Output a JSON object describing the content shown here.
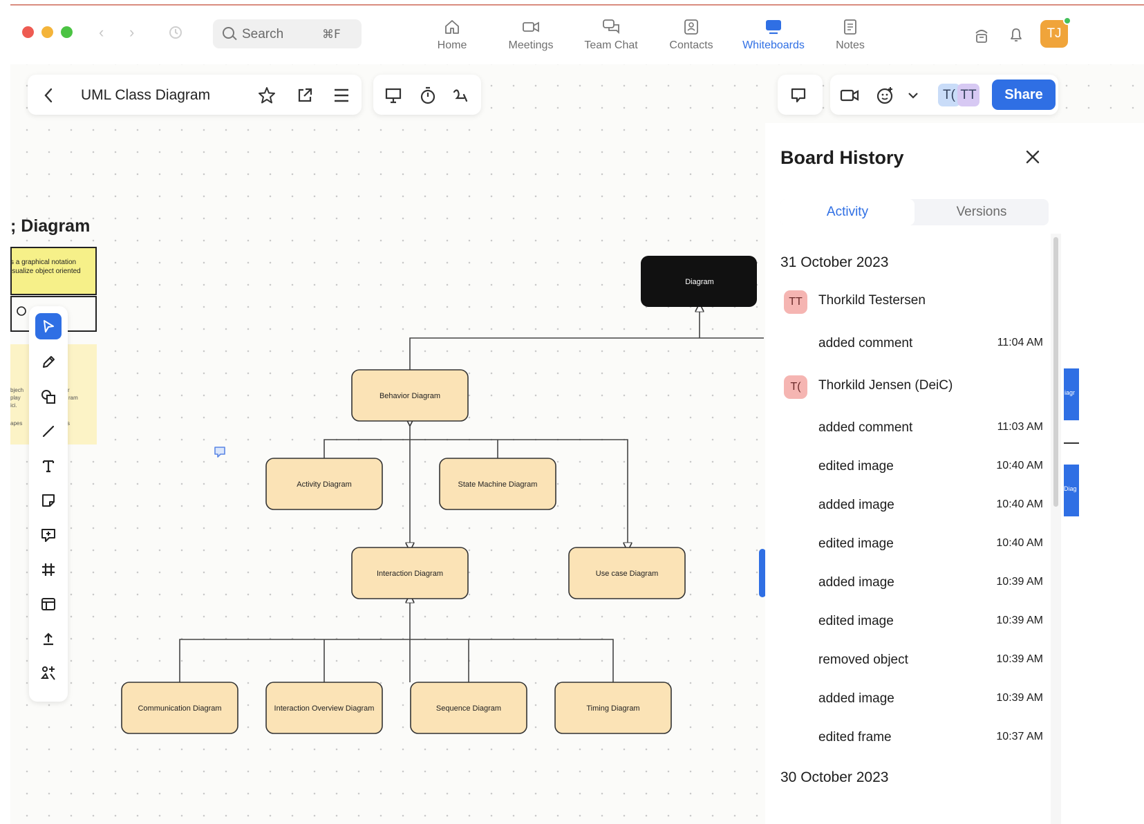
{
  "search": {
    "placeholder": "Search",
    "shortcut": "⌘F"
  },
  "nav_tabs": [
    {
      "label": "Home",
      "icon": "home-icon"
    },
    {
      "label": "Meetings",
      "icon": "video-camera-icon"
    },
    {
      "label": "Team Chat",
      "icon": "chat-bubbles-icon"
    },
    {
      "label": "Contacts",
      "icon": "contact-card-icon"
    },
    {
      "label": "Whiteboards",
      "icon": "whiteboard-icon",
      "active": true
    },
    {
      "label": "Notes",
      "icon": "notes-icon"
    }
  ],
  "user": {
    "initials": "TJ"
  },
  "board": {
    "title": "UML Class Diagram"
  },
  "collaborators": [
    "T(",
    "TT"
  ],
  "share_label": "Share",
  "left_frame": {
    "heading": "; Diagram",
    "sticky_line1": "s a graphical notation",
    "sticky_line2": "isualize object oriented",
    "pale_fragments": [
      "bjech",
      "r",
      "play",
      "ram",
      "ici.",
      "apes",
      "s"
    ]
  },
  "diagram": {
    "nodes": [
      {
        "id": "diagram",
        "label": "Diagram",
        "dark": true
      },
      {
        "id": "behavior",
        "label": "Behavior Diagram"
      },
      {
        "id": "activity",
        "label": "Activity Diagram"
      },
      {
        "id": "state",
        "label": "State Machine Diagram"
      },
      {
        "id": "interaction",
        "label": "Interaction Diagram"
      },
      {
        "id": "usecase",
        "label": "Use case Diagram"
      },
      {
        "id": "communication",
        "label": "Communication Diagram"
      },
      {
        "id": "overview",
        "label": "Interaction Overview Diagram"
      },
      {
        "id": "sequence",
        "label": "Sequence Diagram"
      },
      {
        "id": "timing",
        "label": "Timing Diagram"
      }
    ],
    "right_fragments": [
      "iagr",
      "Diag"
    ]
  },
  "panel": {
    "title": "Board History",
    "tabs": [
      "Activity",
      "Versions"
    ],
    "active_tab": "Activity",
    "groups": [
      {
        "date": "31 October 2023",
        "users": [
          {
            "initials": "TT",
            "name": "Thorkild Testersen",
            "events": [
              {
                "action": "added comment",
                "time": "11:04 AM"
              }
            ]
          },
          {
            "initials": "T(",
            "name": "Thorkild Jensen (DeiC)",
            "events": [
              {
                "action": "added comment",
                "time": "11:03 AM"
              },
              {
                "action": "edited image",
                "time": "10:40 AM"
              },
              {
                "action": "added image",
                "time": "10:40 AM"
              },
              {
                "action": "edited image",
                "time": "10:40 AM"
              },
              {
                "action": "added image",
                "time": "10:39 AM"
              },
              {
                "action": "edited image",
                "time": "10:39 AM"
              },
              {
                "action": "removed object",
                "time": "10:39 AM"
              },
              {
                "action": "added image",
                "time": "10:39 AM"
              },
              {
                "action": "edited frame",
                "time": "10:37 AM"
              }
            ]
          }
        ]
      },
      {
        "date": "30 October 2023",
        "users": []
      }
    ]
  },
  "colors": {
    "accent": "#2f6fe4",
    "node_fill": "#fbe3b6",
    "node_dark": "#111111",
    "sticky_yellow": "#f6f089",
    "avatar_pink": "#f5b5b2",
    "user_orange": "#f0a43a"
  }
}
